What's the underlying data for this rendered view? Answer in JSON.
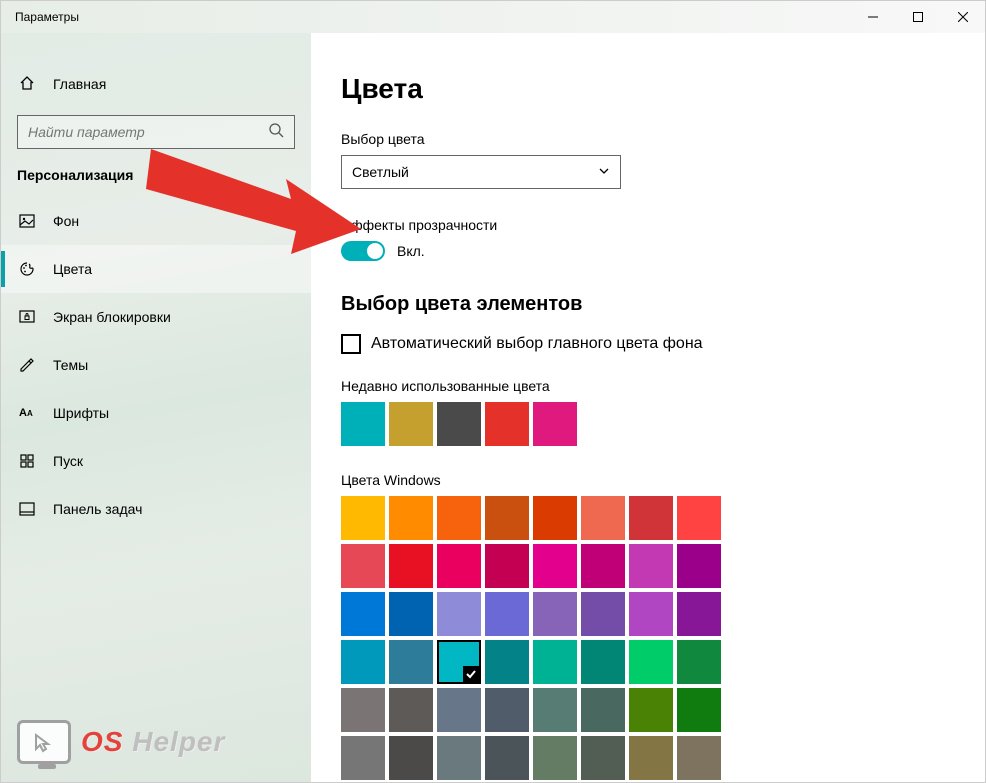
{
  "window": {
    "title": "Параметры"
  },
  "sidebar": {
    "home": "Главная",
    "search_placeholder": "Найти параметр",
    "section": "Персонализация",
    "items": [
      {
        "label": "Фон"
      },
      {
        "label": "Цвета"
      },
      {
        "label": "Экран блокировки"
      },
      {
        "label": "Темы"
      },
      {
        "label": "Шрифты"
      },
      {
        "label": "Пуск"
      },
      {
        "label": "Панель задач"
      }
    ]
  },
  "page": {
    "title": "Цвета",
    "colormode_label": "Выбор цвета",
    "colormode_value": "Светлый",
    "transparency_label": "Эффекты прозрачности",
    "toggle_state": "Вкл.",
    "accent_heading": "Выбор цвета элементов",
    "auto_checkbox": "Автоматический выбор главного цвета фона",
    "recent_label": "Недавно использованные цвета",
    "recent_colors": [
      "#00b0b9",
      "#c6a02e",
      "#4a4a4a",
      "#e4322b",
      "#e0197f"
    ],
    "windows_colors_label": "Цвета Windows",
    "windows_colors": [
      "#ffb900",
      "#ff8c00",
      "#f7630c",
      "#ca5010",
      "#da3b01",
      "#ef6950",
      "#d13438",
      "#ff4343",
      "#e74856",
      "#e81123",
      "#ea005e",
      "#c30052",
      "#e3008c",
      "#bf0077",
      "#c239b3",
      "#9a0089",
      "#0078d7",
      "#0063b1",
      "#8e8cd8",
      "#6b69d6",
      "#8764b8",
      "#744da9",
      "#b146c2",
      "#881798",
      "#0099bc",
      "#2d7d9a",
      "#00b7c3",
      "#038387",
      "#00b294",
      "#018574",
      "#00cc6a",
      "#10893e",
      "#7a7574",
      "#5d5a58",
      "#68768a",
      "#515c6b",
      "#567c73",
      "#486860",
      "#498205",
      "#107c10",
      "#767676",
      "#4c4a48",
      "#69797e",
      "#4a5459",
      "#647c64",
      "#525e54",
      "#847545",
      "#7e735f"
    ],
    "selected_color_index": 26
  },
  "watermark": {
    "os": "OS",
    "helper": " Helper"
  }
}
